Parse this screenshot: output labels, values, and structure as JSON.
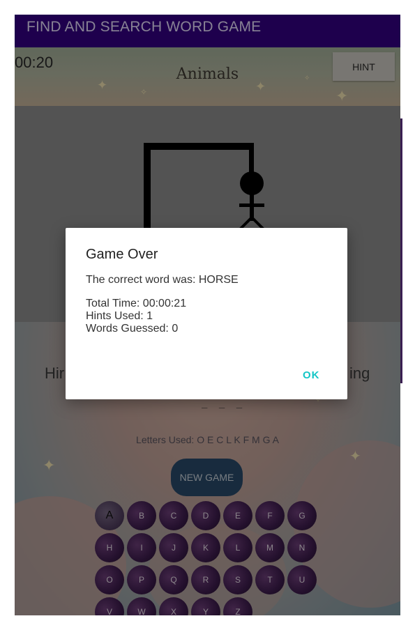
{
  "app": {
    "title": "FIND AND SEARCH WORD GAME"
  },
  "header": {
    "timer": "00:20",
    "category": "Animals",
    "hint_label": "HINT"
  },
  "game": {
    "side_left": "Hir",
    "side_right": "ing",
    "word_blanks": "_ _ _",
    "letters_used": "Letters Used: O E C L K F M G A",
    "new_game_label": "NEW GAME"
  },
  "keyboard": {
    "rows": [
      [
        "A",
        "B",
        "C",
        "D",
        "E",
        "F",
        "G"
      ],
      [
        "H",
        "I",
        "J",
        "K",
        "L",
        "M",
        "N"
      ],
      [
        "O",
        "P",
        "Q",
        "R",
        "S",
        "T",
        "U"
      ],
      [
        "V",
        "W",
        "X",
        "Y",
        "Z"
      ]
    ]
  },
  "dialog": {
    "title": "Game Over",
    "message": "The correct word was: HORSE",
    "total_time": "Total Time: 00:00:21",
    "hints_used": "Hints Used: 1",
    "words_guessed": "Words Guessed: 0",
    "ok_label": "OK"
  },
  "colors": {
    "app_bar": "#350085",
    "accent": "#14c6c6",
    "key_fill": "#3f1d4f"
  }
}
